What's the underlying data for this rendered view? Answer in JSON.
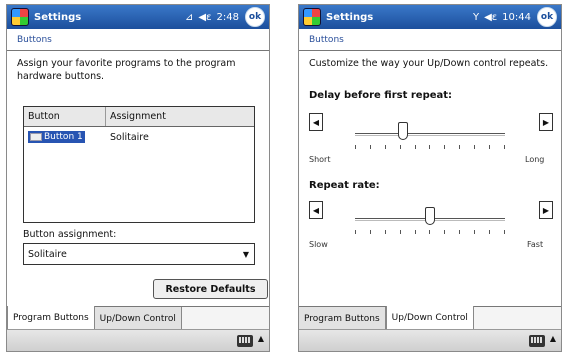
{
  "left": {
    "title": "Settings",
    "status": {
      "signal": "⊿",
      "volume": "◀ε",
      "time": "2:48",
      "ok": "ok"
    },
    "subtitle": "Buttons",
    "description": "Assign your favorite programs to the program hardware buttons.",
    "table": {
      "headers": [
        "Button",
        "Assignment"
      ],
      "rows": [
        {
          "button": "Button 1",
          "assignment": "Solitaire"
        }
      ]
    },
    "field_label": "Button assignment:",
    "dropdown_value": "Solitaire",
    "restore_label": "Restore Defaults",
    "tabs": [
      "Program Buttons",
      "Up/Down Control"
    ],
    "active_tab": 0
  },
  "right": {
    "title": "Settings",
    "status": {
      "signal": "Y",
      "volume": "◀ε",
      "time": "10:44",
      "ok": "ok"
    },
    "subtitle": "Buttons",
    "description": "Customize the way your Up/Down control repeats.",
    "sliders": [
      {
        "label": "Delay before first repeat:",
        "min_label": "Short",
        "max_label": "Long",
        "value_fraction": 0.32
      },
      {
        "label": "Repeat rate:",
        "min_label": "Slow",
        "max_label": "Fast",
        "value_fraction": 0.5
      }
    ],
    "tabs": [
      "Program Buttons",
      "Up/Down Control"
    ],
    "active_tab": 1
  },
  "icons": {
    "start": "windows-flag-icon",
    "keyboard": "keyboard-icon",
    "menu_up": "up-arrow-icon"
  }
}
